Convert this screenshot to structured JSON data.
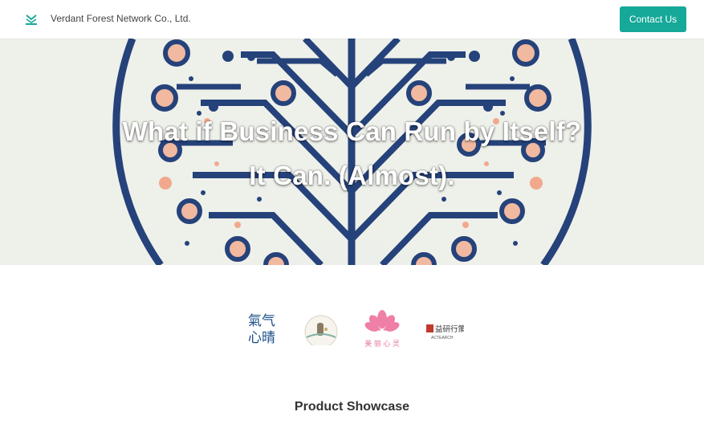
{
  "header": {
    "company_name": "Verdant Forest Network Co., Ltd.",
    "contact_button": "Contact Us"
  },
  "hero": {
    "line1": "What if Business Can Run by Itself?",
    "line2": "It Can. (Almost)."
  },
  "partners": [
    {
      "name": "氣氛心晴",
      "icon": "qifen-xinqing-logo"
    },
    {
      "name": "circular-badge-logo",
      "icon": "circle-badge-logo"
    },
    {
      "name": "美麗心靈",
      "icon": "lotus-logo"
    },
    {
      "name": "益研行策",
      "icon": "actearch-logo"
    }
  ],
  "partner_labels": {
    "p1_line1": "氣气",
    "p1_line2": "心晴",
    "p3_text": "美 丽 心 灵",
    "p4_text": "益研行策",
    "p4_sub": "ACTEARCH"
  },
  "colors": {
    "accent": "#16a899",
    "circuit_blue": "#25427a",
    "node_peach": "#f0b9a0"
  },
  "sections": {
    "product_title": "Product Showcase"
  }
}
